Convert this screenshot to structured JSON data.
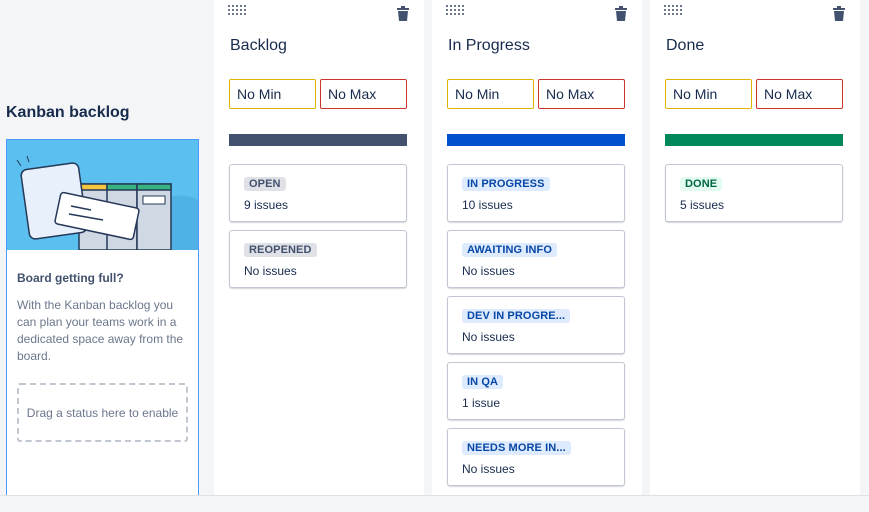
{
  "backlog": {
    "title": "Kanban backlog",
    "heading": "Board getting full?",
    "description": "With the Kanban backlog you can plan your teams work in a dedicated space away from the board.",
    "drop_zone": "Drag a status here to enable"
  },
  "columns": [
    {
      "title": "Backlog",
      "min_placeholder": "No Min",
      "max_placeholder": "No Max",
      "bar_color": "#42526e",
      "statuses": [
        {
          "name": "OPEN",
          "count": "9 issues",
          "color": "grey"
        },
        {
          "name": "REOPENED",
          "count": "No issues",
          "color": "grey"
        }
      ]
    },
    {
      "title": "In Progress",
      "min_placeholder": "No Min",
      "max_placeholder": "No Max",
      "bar_color": "#0052cc",
      "statuses": [
        {
          "name": "IN PROGRESS",
          "count": "10 issues",
          "color": "blue"
        },
        {
          "name": "AWAITING INFO",
          "count": "No issues",
          "color": "blue"
        },
        {
          "name": "DEV IN PROGRE...",
          "count": "No issues",
          "color": "blue"
        },
        {
          "name": "IN QA",
          "count": "1 issue",
          "color": "blue"
        },
        {
          "name": "NEEDS MORE IN...",
          "count": "No issues",
          "color": "blue"
        }
      ]
    },
    {
      "title": "Done",
      "min_placeholder": "No Min",
      "max_placeholder": "No Max",
      "bar_color": "#00875a",
      "statuses": [
        {
          "name": "DONE",
          "count": "5 issues",
          "color": "green"
        }
      ]
    }
  ],
  "icons": {
    "grip": "drag-handle-icon",
    "delete": "trash-icon"
  }
}
